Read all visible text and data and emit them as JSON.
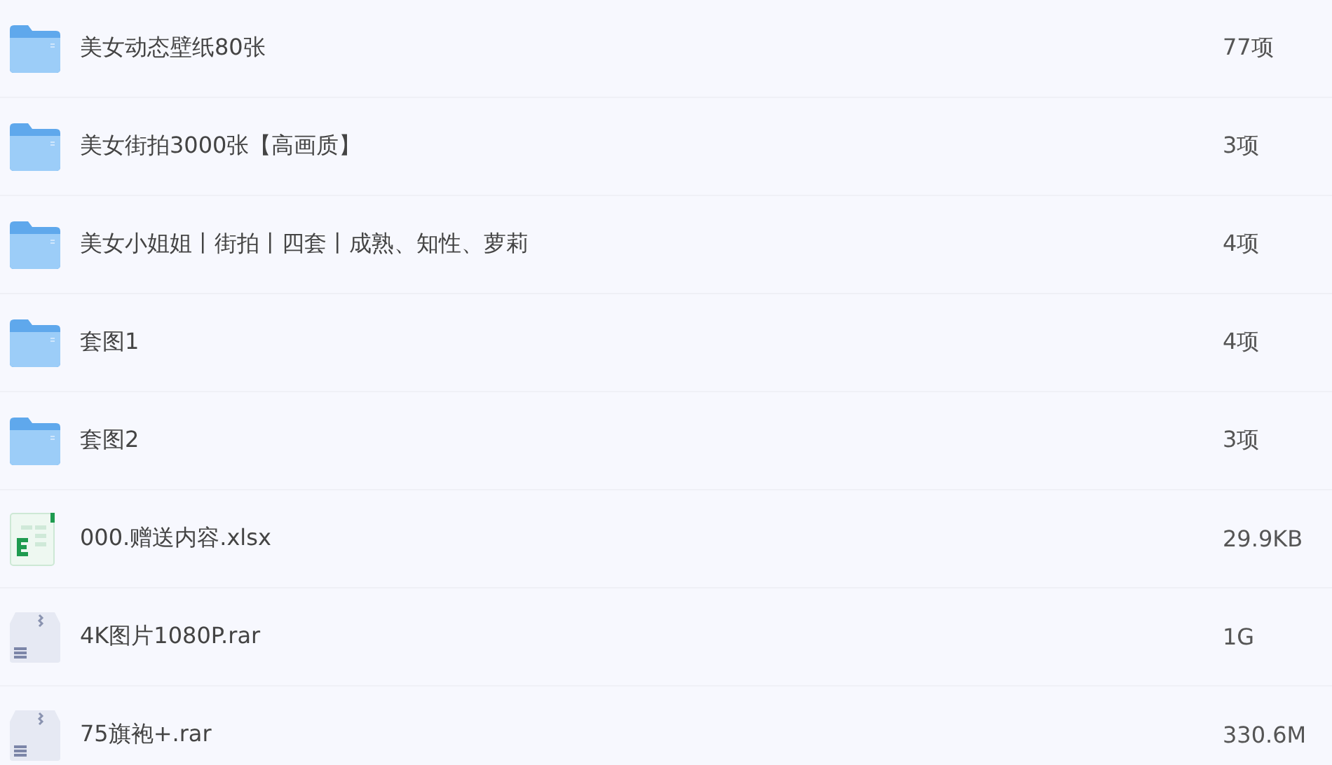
{
  "files": [
    {
      "kind": "folder",
      "name": "美女动态壁纸80张",
      "size": "77项"
    },
    {
      "kind": "folder",
      "name": "美女街拍3000张【高画质】",
      "size": "3项"
    },
    {
      "kind": "folder",
      "name": "美女小姐姐丨街拍丨四套丨成熟、知性、萝莉",
      "size": "4项"
    },
    {
      "kind": "folder",
      "name": "套图1",
      "size": "4项"
    },
    {
      "kind": "folder",
      "name": "套图2",
      "size": "3项"
    },
    {
      "kind": "excel",
      "name": "000.赠送内容.xlsx",
      "size": "29.9KB"
    },
    {
      "kind": "archive",
      "name": "4K图片1080P.rar",
      "size": "1G"
    },
    {
      "kind": "archive",
      "name": "75旗袍+.rar",
      "size": "330.6M"
    }
  ]
}
